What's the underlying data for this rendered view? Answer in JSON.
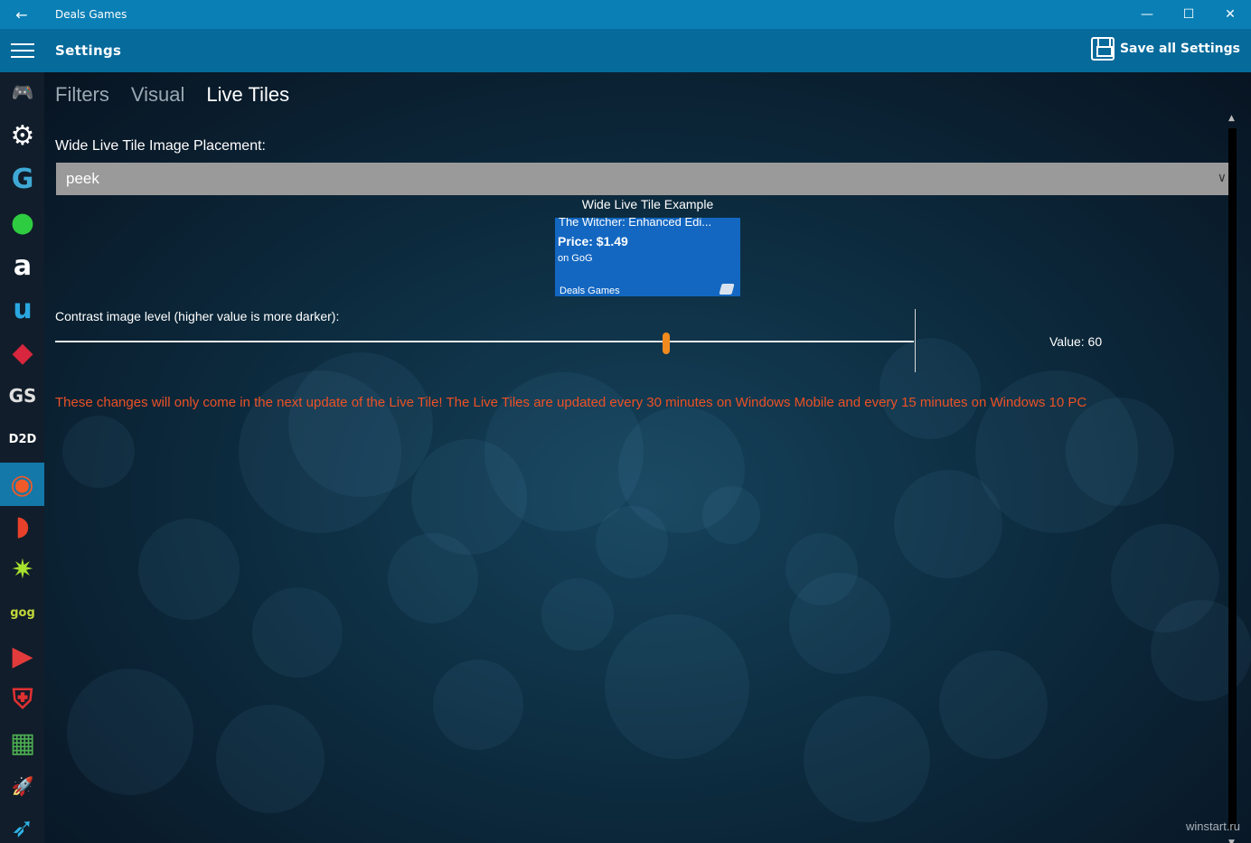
{
  "window": {
    "title": "Deals Games",
    "back_glyph": "←",
    "minimize_glyph": "—",
    "maximize_glyph": "☐",
    "close_glyph": "✕"
  },
  "header": {
    "title": "Settings",
    "save_label": "Save all Settings"
  },
  "tabs": [
    "Filters",
    "Visual",
    "Live Tiles"
  ],
  "active_tab": "Live Tiles",
  "placement": {
    "label": "Wide Live Tile Image Placement:",
    "selected": "peek"
  },
  "tile_example": {
    "caption": "Wide Live Tile Example",
    "game": "The Witcher: Enhanced Edi...",
    "price": "Price: $1.49",
    "store": "on GoG",
    "app": "Deals Games"
  },
  "contrast": {
    "label": "Contrast image level (higher value is more darker):",
    "value": 60,
    "min": 0,
    "max": 100,
    "value_label": "Value: 60"
  },
  "warning": "These changes will only come in the next update of the Live Tile! The Live Tiles are updated every 30 minutes on Windows Mobile and every 15 minutes on Windows 10 PC",
  "watermark": "winstart.ru",
  "sidebar": [
    {
      "icon": "topdeals-icon",
      "glyph": "🎮",
      "color": "#dddddd"
    },
    {
      "icon": "steam-icon",
      "glyph": "⚙",
      "color": "#ffffff"
    },
    {
      "icon": "greenmangaming-icon",
      "glyph": "G",
      "color": "#3fa9d6"
    },
    {
      "icon": "greenman-icon",
      "glyph": "●",
      "color": "#2ecc40"
    },
    {
      "icon": "amazon-icon",
      "glyph": "a",
      "color": "#ffffff"
    },
    {
      "icon": "uplay-icon",
      "glyph": "u",
      "color": "#2aa7e0"
    },
    {
      "icon": "humble-icon",
      "glyph": "◆",
      "color": "#d7263d"
    },
    {
      "icon": "gamersgate-icon",
      "glyph": "GS",
      "color": "#e0e0e0"
    },
    {
      "icon": "g2a-icon",
      "glyph": "D2D",
      "color": "#ffffff"
    },
    {
      "icon": "origin-icon",
      "glyph": "◉",
      "color": "#f05a28"
    },
    {
      "icon": "gamesplanet-icon",
      "glyph": "◗",
      "color": "#e8412b"
    },
    {
      "icon": "indiegala-icon",
      "glyph": "✷",
      "color": "#a6e22e"
    },
    {
      "icon": "gog-icon",
      "glyph": "gog",
      "color": "#c3d83a"
    },
    {
      "icon": "playasia-icon",
      "glyph": "▶",
      "color": "#e23b3b"
    },
    {
      "icon": "gamesrocket-icon",
      "glyph": "⛨",
      "color": "#e03131"
    },
    {
      "icon": "windowsstore-icon",
      "glyph": "▦",
      "color": "#4caf50"
    },
    {
      "icon": "rocket-icon",
      "glyph": "🚀",
      "color": "#ffffff"
    },
    {
      "icon": "shuttle-icon",
      "glyph": "➶",
      "color": "#2db3e6"
    }
  ]
}
